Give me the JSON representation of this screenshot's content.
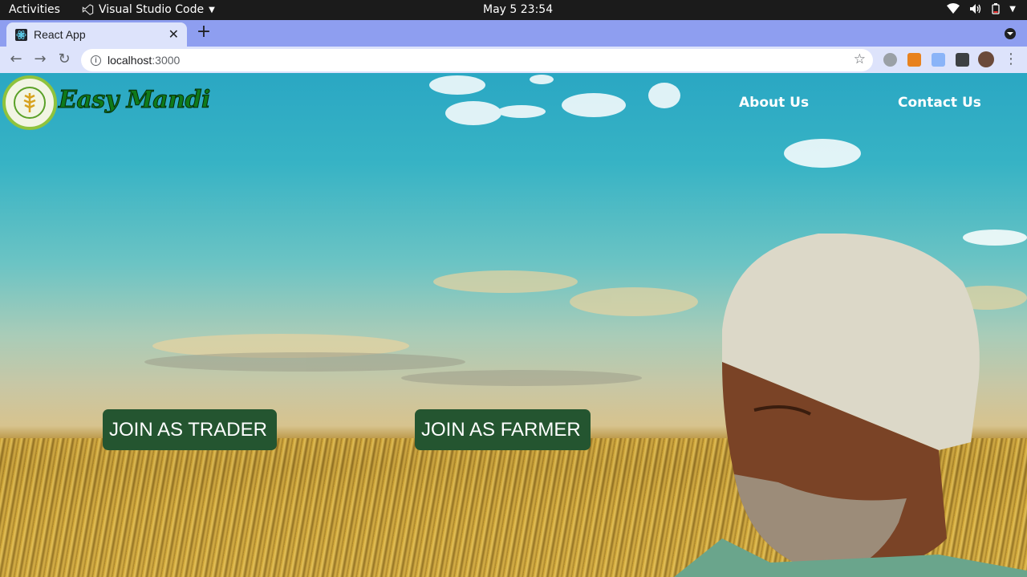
{
  "system": {
    "activities": "Activities",
    "app_name": "Visual Studio Code",
    "clock": "May 5  23:54"
  },
  "browser": {
    "tab_title": "React App",
    "url_host": "localhost",
    "url_port": ":3000"
  },
  "page": {
    "brand": "Easy Mandi",
    "nav": {
      "about": "About Us",
      "contact": "Contact Us"
    },
    "buttons": {
      "join_trader": "JOIN AS TRADER",
      "join_farmer": "JOIN AS FARMER"
    }
  },
  "colors": {
    "button_bg": "#245530",
    "tab_strip": "#8e9ef0",
    "toolbar": "#dde3fb",
    "brand_text": "#0f7a1a"
  }
}
